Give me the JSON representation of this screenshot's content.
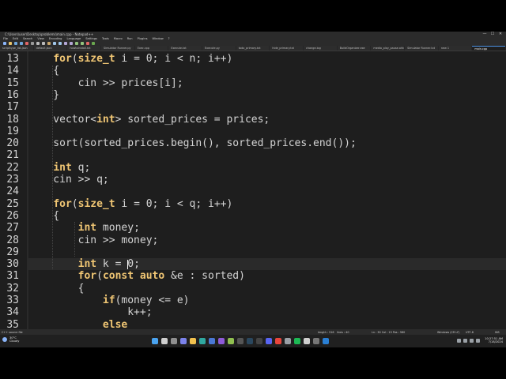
{
  "window": {
    "title": "C:\\Users\\user\\Desktop\\problems\\main.cpp - Notepad++",
    "controls": [
      "—",
      "☐",
      "✕"
    ]
  },
  "menu": [
    "File",
    "Edit",
    "Search",
    "View",
    "Encoding",
    "Language",
    "Settings",
    "Tools",
    "Macro",
    "Run",
    "Plugins",
    "Window",
    "?"
  ],
  "tabs": [
    {
      "label": "scripttype_list.json"
    },
    {
      "label": "default.json"
    },
    {
      "label": "howtoinstall.txt"
    },
    {
      "label": "Simulator Runner.py"
    },
    {
      "label": "Exec.cpp"
    },
    {
      "label": "Execute.txt"
    },
    {
      "label": "Execute.py"
    },
    {
      "label": "todo_primary.txt"
    },
    {
      "label": "hide_primary.txt"
    },
    {
      "label": "change.log"
    },
    {
      "label": "BuildOrganizer.exe"
    },
    {
      "label": "media_play_pause.ahk"
    },
    {
      "label": "Simulator Runner.txt"
    },
    {
      "label": "new 1"
    },
    {
      "label": "main.cpp",
      "active": true
    }
  ],
  "code": {
    "lines": [
      {
        "n": "13",
        "text": "    for(size_t i = 0; i < n; i++)",
        "kw": [
          "for",
          "size_t"
        ]
      },
      {
        "n": "14",
        "text": "    {"
      },
      {
        "n": "15",
        "text": "        cin >> prices[i];"
      },
      {
        "n": "16",
        "text": "    }"
      },
      {
        "n": "17",
        "text": ""
      },
      {
        "n": "18",
        "text": "    vector<int> sorted_prices = prices;",
        "kw": [
          "int"
        ]
      },
      {
        "n": "19",
        "text": ""
      },
      {
        "n": "20",
        "text": "    sort(sorted_prices.begin(), sorted_prices.end());"
      },
      {
        "n": "21",
        "text": ""
      },
      {
        "n": "22",
        "text": "    int q;",
        "kw": [
          "int"
        ]
      },
      {
        "n": "23",
        "text": "    cin >> q;"
      },
      {
        "n": "24",
        "text": ""
      },
      {
        "n": "25",
        "text": "    for(size_t i = 0; i < q; i++)",
        "kw": [
          "for",
          "size_t"
        ]
      },
      {
        "n": "26",
        "text": "    {"
      },
      {
        "n": "27",
        "text": "        int money;",
        "kw": [
          "int"
        ]
      },
      {
        "n": "28",
        "text": "        cin >> money;"
      },
      {
        "n": "29",
        "text": ""
      },
      {
        "n": "30",
        "text": "        int k = 0;",
        "kw": [
          "int"
        ]
      },
      {
        "n": "31",
        "text": "        for(const auto &e : sorted)",
        "kw": [
          "for",
          "const",
          "auto"
        ]
      },
      {
        "n": "32",
        "text": "        {"
      },
      {
        "n": "33",
        "text": "            if(money <= e)",
        "kw": [
          "if"
        ]
      },
      {
        "n": "34",
        "text": "                k++;"
      },
      {
        "n": "35",
        "text": "            else",
        "kw": [
          "else"
        ]
      }
    ],
    "current_line": "30"
  },
  "status": {
    "language": "C++ source file",
    "length": "length : 516",
    "lines": "lines : 40",
    "position": "Ln : 30    Col : 15    Pos : 580",
    "eol": "Windows (CR LF)",
    "encoding": "UTF-8",
    "mode": "INS"
  },
  "weather": {
    "temp": "30°C",
    "cond": "Cloudy"
  },
  "clock": {
    "time": "10:27:51 AM",
    "date": "7/18/2024"
  },
  "colors": {
    "keyword": "#f0c674",
    "text": "#d4d4d4",
    "background": "#1e1e1e",
    "current_line": "#2a2a2a"
  }
}
